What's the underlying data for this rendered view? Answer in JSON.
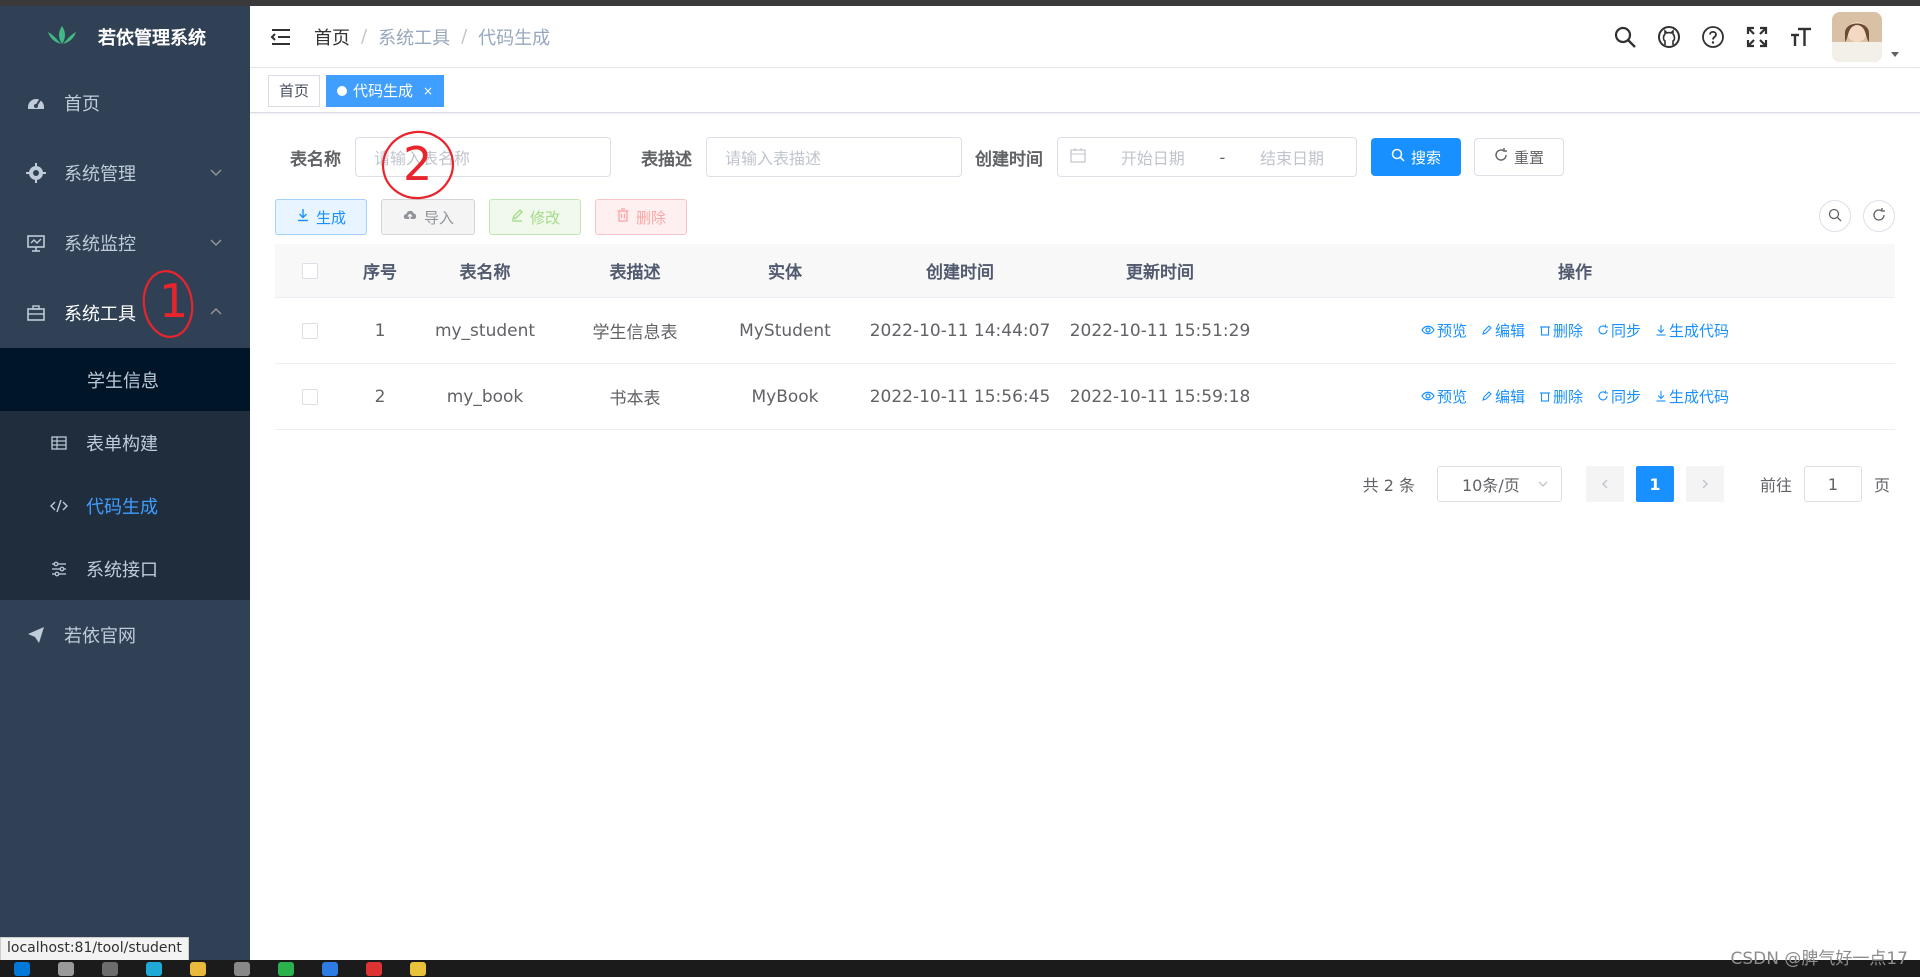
{
  "app": {
    "title": "若依管理系统"
  },
  "sidebar": {
    "items": [
      {
        "label": "首页",
        "icon": "dashboard-icon"
      },
      {
        "label": "系统管理",
        "icon": "gear-icon"
      },
      {
        "label": "系统监控",
        "icon": "monitor-icon"
      },
      {
        "label": "系统工具",
        "icon": "toolbox-icon"
      },
      {
        "label": "若依官网",
        "icon": "send-icon"
      }
    ],
    "sub_items": [
      {
        "label": "学生信息"
      },
      {
        "label": "表单构建",
        "icon": "grid-icon"
      },
      {
        "label": "代码生成",
        "icon": "code-icon"
      },
      {
        "label": "系统接口",
        "icon": "sliders-icon"
      }
    ]
  },
  "breadcrumb": {
    "home": "首页",
    "sep": "/",
    "level1": "系统工具",
    "level2": "代码生成"
  },
  "tags": {
    "home": "首页",
    "active": "代码生成",
    "close": "×"
  },
  "search": {
    "table_name_label": "表名称",
    "table_name_placeholder": "请输入表名称",
    "table_desc_label": "表描述",
    "table_desc_placeholder": "请输入表描述",
    "created_label": "创建时间",
    "start_placeholder": "开始日期",
    "range_sep": "-",
    "end_placeholder": "结束日期",
    "search_btn": "搜索",
    "reset_btn": "重置"
  },
  "toolbar": {
    "generate": "生成",
    "import": "导入",
    "edit": "修改",
    "delete": "删除"
  },
  "table": {
    "headers": {
      "idx": "序号",
      "name": "表名称",
      "desc": "表描述",
      "cls": "实体",
      "ct": "创建时间",
      "ut": "更新时间",
      "ops": "操作"
    },
    "rows": [
      {
        "idx": "1",
        "name": "my_student",
        "desc": "学生信息表",
        "cls": "MyStudent",
        "ct": "2022-10-11 14:44:07",
        "ut": "2022-10-11 15:51:29"
      },
      {
        "idx": "2",
        "name": "my_book",
        "desc": "书本表",
        "cls": "MyBook",
        "ct": "2022-10-11 15:56:45",
        "ut": "2022-10-11 15:59:18"
      }
    ],
    "ops": {
      "preview": "预览",
      "edit": "编辑",
      "delete": "删除",
      "sync": "同步",
      "gen": "生成代码"
    }
  },
  "pagination": {
    "total": "共 2 条",
    "page_size": "10条/页",
    "current": "1",
    "goto": "前往",
    "goto_value": "1",
    "page_unit": "页"
  },
  "annotations": {
    "a1": "1",
    "a2": "2"
  },
  "status": {
    "url": "localhost:81/tool/student"
  },
  "watermark": "CSDN @脾气好一点17",
  "colors": {
    "sidebar": "#304156",
    "primary": "#1890ff",
    "annotation": "#e8242d"
  }
}
